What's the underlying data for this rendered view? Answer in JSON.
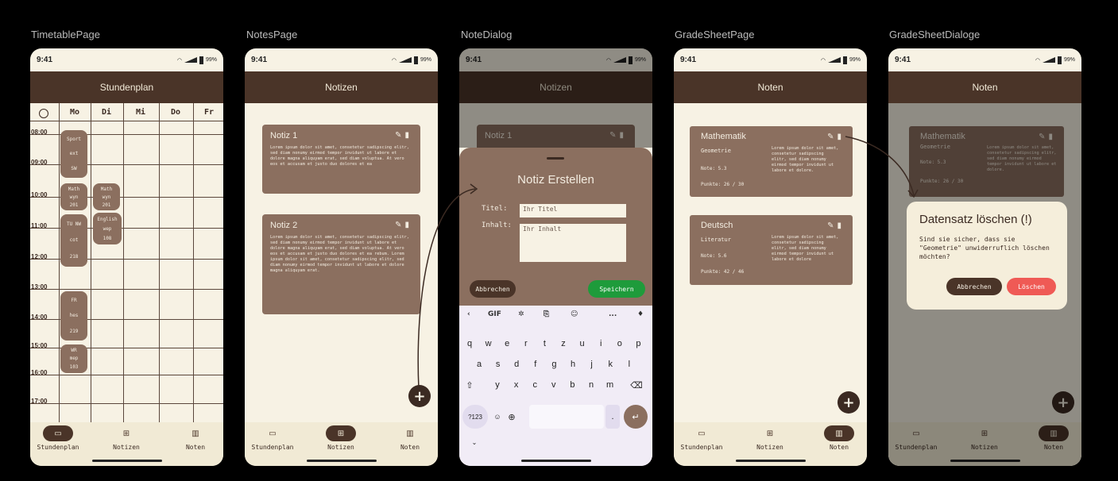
{
  "frames": [
    "TimetablePage",
    "NotesPage",
    "NoteDialog",
    "GradeSheetPage",
    "GradeSheetDialoge"
  ],
  "status": {
    "time": "9:41",
    "battery": "99%"
  },
  "nav": {
    "timetable": "Stundenplan",
    "notes": "Notizen",
    "grades": "Noten"
  },
  "timetable": {
    "title": "Stundenplan",
    "days": [
      "Mo",
      "Di",
      "Mi",
      "Do",
      "Fr"
    ],
    "times": [
      "08:00",
      "09:00",
      "10:00",
      "11:00",
      "12:00",
      "13:00",
      "14:00",
      "15:00",
      "16:00",
      "17:00"
    ],
    "blocks": [
      {
        "day": 0,
        "lines": [
          "Sport",
          "ext",
          "SW"
        ]
      },
      {
        "day": 0,
        "lines": [
          "Math",
          "wyn",
          "201"
        ]
      },
      {
        "day": 1,
        "lines": [
          "Math",
          "wyn",
          "201"
        ]
      },
      {
        "day": 0,
        "lines": [
          "TU NW",
          "cot",
          "218"
        ]
      },
      {
        "day": 1,
        "lines": [
          "English",
          "wep",
          "108"
        ]
      },
      {
        "day": 0,
        "lines": [
          "FR",
          "hes",
          "219"
        ]
      },
      {
        "day": 0,
        "lines": [
          "WR",
          "mep",
          "103"
        ]
      }
    ]
  },
  "notes": {
    "title": "Notizen",
    "items": [
      {
        "title": "Notiz 1",
        "body": "Lorem ipsum dolor sit amet, consetetur sadipscing elitr, sed diam nonumy eirmod tempor invidunt ut labore et dolore magna aliquyam erat, sed diam voluptua. At vero eos et accusam et justo duo dolores et ea"
      },
      {
        "title": "Notiz 2",
        "body": "Lorem ipsum dolor sit amet, consetetur sadipscing elitr, sed diam nonumy eirmod tempor invidunt ut labore et dolore magna aliquyam erat, sed diam voluptua. At vero eos et accusam et justo duo dolores et ea rebum. Lorem ipsum dolor sit amet, consetetur sadipscing elitr, sed diam nonumy eirmod tempor invidunt ut labore et dolore magna aliquyam erat."
      }
    ]
  },
  "note_dialog": {
    "title": "Notiz Erstellen",
    "title_label": "Titel:",
    "title_placeholder": "Ihr Titel",
    "content_label": "Inhalt:",
    "content_placeholder": "Ihr Inhalt",
    "cancel": "Abbrechen",
    "save": "Speichern"
  },
  "keyboard": {
    "toolbar": [
      "GIF",
      "..."
    ],
    "row1": [
      "q",
      "w",
      "e",
      "r",
      "t",
      "z",
      "u",
      "i",
      "o",
      "p"
    ],
    "row2": [
      "a",
      "s",
      "d",
      "f",
      "g",
      "h",
      "j",
      "k",
      "l"
    ],
    "row3": [
      "y",
      "x",
      "c",
      "v",
      "b",
      "n",
      "m"
    ],
    "num": "?123",
    "dot": "."
  },
  "grades": {
    "title": "Noten",
    "items": [
      {
        "subject": "Mathematik",
        "topic": "Geometrie",
        "grade": "Note: 5.3",
        "points": "Punkte: 26 / 30",
        "body": "Lorem ipsum dolor sit amet, consetetur sadipscing elitr, sed diam nonumy eirmod tempor invidunt ut labore et dolore."
      },
      {
        "subject": "Deutsch",
        "topic": "Literatur",
        "grade": "Note: 5.6",
        "points": "Punkte: 42 / 46",
        "body": "Lorem ipsum dolor sit amet, consetetur sadipscing elitr, sed diam nonumy eirmod tempor invidunt ut labore et dolore"
      }
    ]
  },
  "delete_dialog": {
    "title": "Datensatz löschen (!)",
    "message": "Sind sie sicher, dass sie \"Geometrie\" unwiderruflich löschen möchten?",
    "cancel": "Abbrechen",
    "delete": "Löschen"
  },
  "colors": {
    "brown_dark": "#4a3428",
    "brown_card": "#8b6f5f",
    "cream": "#f7f2e4",
    "green": "#1e9b3b",
    "red": "#ef5a55"
  }
}
